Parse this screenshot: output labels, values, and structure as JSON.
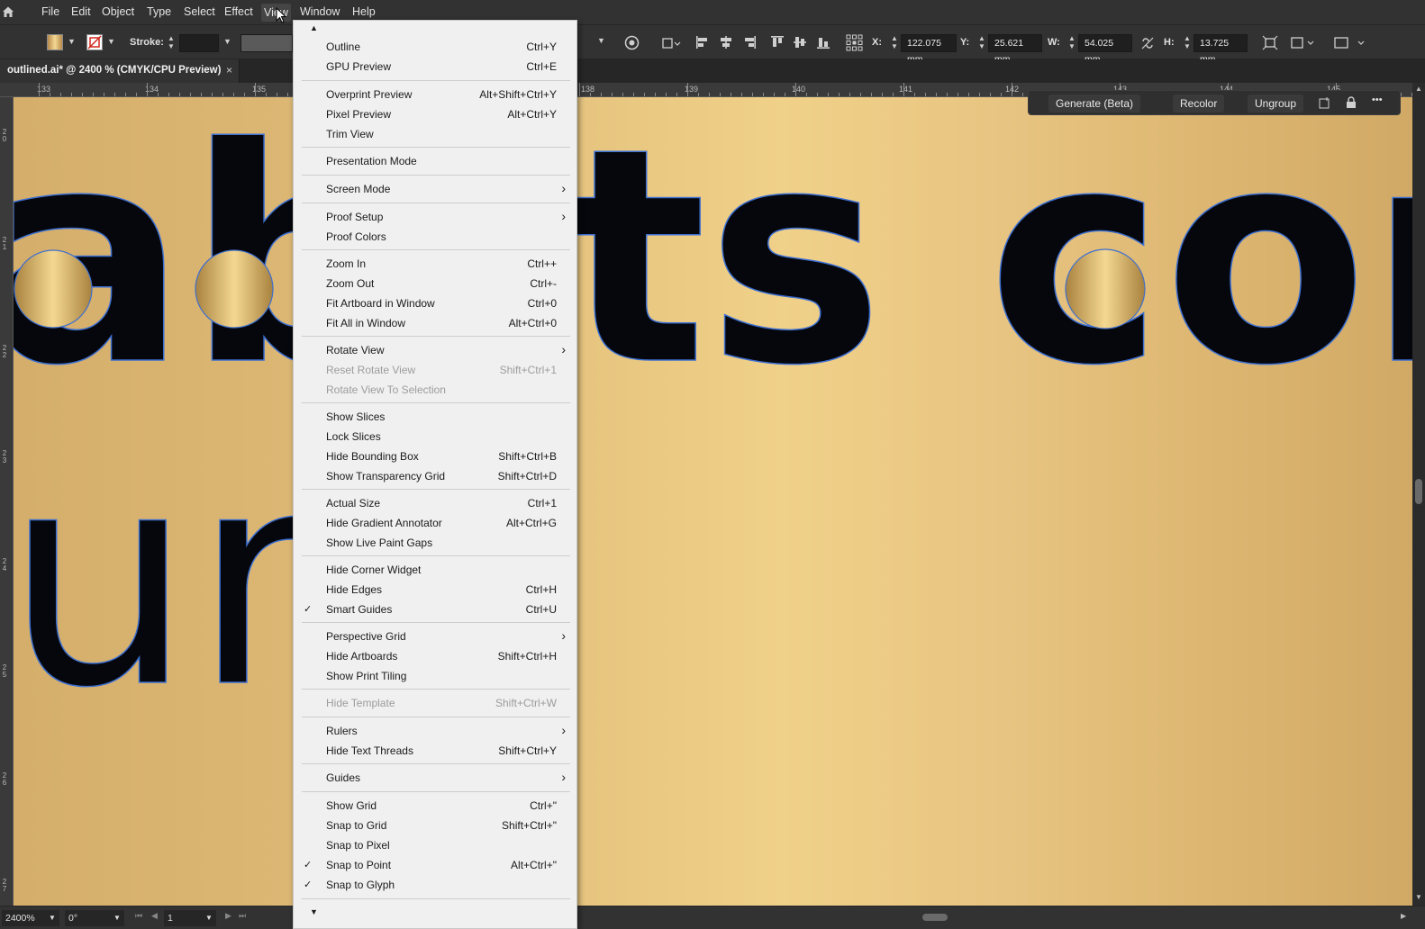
{
  "menubar": {
    "items": [
      "File",
      "Edit",
      "Object",
      "Type",
      "Select",
      "Effect",
      "View",
      "Window",
      "Help"
    ],
    "active": "View"
  },
  "control": {
    "stroke_label": "Stroke:",
    "x_label": "X:",
    "x_value": "122.075 mm",
    "y_label": "Y:",
    "y_value": "25.621 mm",
    "w_label": "W:",
    "w_value": "54.025 mm",
    "h_label": "H:",
    "h_value": "13.725 mm"
  },
  "doc": {
    "tab_title": "outlined.ai* @ 2400 % (CMYK/CPU Preview)",
    "close": "×"
  },
  "ruler": {
    "top_labels": [
      "133",
      "134",
      "135",
      "138",
      "139",
      "140",
      "141",
      "142",
      "143",
      "144",
      "145"
    ],
    "left_labels": [
      "2\n0",
      "2\n1",
      "2\n2",
      "2\n3",
      "2\n4",
      "2\n5",
      "2\n6",
      "2\n7"
    ]
  },
  "taskbar": {
    "generate_label": "Generate (Beta)",
    "recolor_label": "Recolor",
    "ungroup_label": "Ungroup",
    "more_label": "•••"
  },
  "status": {
    "zoom": "2400%",
    "rotation": "0°",
    "artboard": "1"
  },
  "canvas_text": {
    "line1_left": "ab",
    "line1_right": "ts cont",
    "line2_left": "um"
  },
  "colors": {
    "gold_light": "#f0d189",
    "gold_dark": "#d1a966",
    "glyph": "#05070c",
    "selection_outline": "#3d6fd1"
  },
  "view_menu": {
    "items": [
      {
        "label": "Outline",
        "shortcut": "Ctrl+Y"
      },
      {
        "label": "GPU Preview",
        "shortcut": "Ctrl+E"
      },
      {
        "label": "Overprint Preview",
        "shortcut": "Alt+Shift+Ctrl+Y"
      },
      {
        "label": "Pixel Preview",
        "shortcut": "Alt+Ctrl+Y"
      },
      {
        "label": "Trim View",
        "shortcut": ""
      },
      {
        "label": "Presentation Mode",
        "shortcut": ""
      },
      {
        "label": "Screen Mode",
        "shortcut": ""
      },
      {
        "label": "Proof Setup",
        "shortcut": ""
      },
      {
        "label": "Proof Colors",
        "shortcut": ""
      },
      {
        "label": "Zoom In",
        "shortcut": "Ctrl++"
      },
      {
        "label": "Zoom Out",
        "shortcut": "Ctrl+-"
      },
      {
        "label": "Fit Artboard in Window",
        "shortcut": "Ctrl+0"
      },
      {
        "label": "Fit All in Window",
        "shortcut": "Alt+Ctrl+0"
      },
      {
        "label": "Rotate View",
        "shortcut": ""
      },
      {
        "label": "Reset Rotate View",
        "shortcut": "Shift+Ctrl+1"
      },
      {
        "label": "Rotate View To Selection",
        "shortcut": ""
      },
      {
        "label": "Show Slices",
        "shortcut": ""
      },
      {
        "label": "Lock Slices",
        "shortcut": ""
      },
      {
        "label": "Hide Bounding Box",
        "shortcut": "Shift+Ctrl+B"
      },
      {
        "label": "Show Transparency Grid",
        "shortcut": "Shift+Ctrl+D"
      },
      {
        "label": "Actual Size",
        "shortcut": "Ctrl+1"
      },
      {
        "label": "Hide Gradient Annotator",
        "shortcut": "Alt+Ctrl+G"
      },
      {
        "label": "Show Live Paint Gaps",
        "shortcut": ""
      },
      {
        "label": "Hide Corner Widget",
        "shortcut": ""
      },
      {
        "label": "Hide Edges",
        "shortcut": "Ctrl+H"
      },
      {
        "label": "Smart Guides",
        "shortcut": "Ctrl+U",
        "checked": true
      },
      {
        "label": "Perspective Grid",
        "shortcut": ""
      },
      {
        "label": "Hide Artboards",
        "shortcut": "Shift+Ctrl+H"
      },
      {
        "label": "Show Print Tiling",
        "shortcut": ""
      },
      {
        "label": "Hide Template",
        "shortcut": "Shift+Ctrl+W"
      },
      {
        "label": "Rulers",
        "shortcut": ""
      },
      {
        "label": "Hide Text Threads",
        "shortcut": "Shift+Ctrl+Y"
      },
      {
        "label": "Guides",
        "shortcut": ""
      },
      {
        "label": "Show Grid",
        "shortcut": "Ctrl+\""
      },
      {
        "label": "Snap to Grid",
        "shortcut": "Shift+Ctrl+\""
      },
      {
        "label": "Snap to Pixel",
        "shortcut": ""
      },
      {
        "label": "Snap to Point",
        "shortcut": "Alt+Ctrl+\"",
        "checked": true
      },
      {
        "label": "Snap to Glyph",
        "shortcut": "",
        "checked": true
      }
    ],
    "check_glyph": "✓",
    "submenu_glyph": "›"
  }
}
